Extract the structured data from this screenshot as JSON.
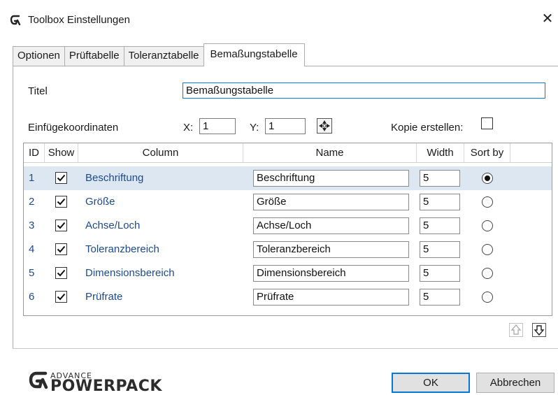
{
  "window": {
    "title": "Toolbox Einstellungen",
    "close_glyph": "✕"
  },
  "tabs": [
    {
      "label": "Optionen"
    },
    {
      "label": "Prüftabelle"
    },
    {
      "label": "Toleranztabelle"
    },
    {
      "label": "Bemaßungstabelle",
      "active": true
    }
  ],
  "form": {
    "titel_label": "Titel",
    "titel_value": "Bemaßungstabelle",
    "coords_label": "Einfügekoordinaten",
    "x_label": "X:",
    "x_value": "1",
    "y_label": "Y:",
    "y_value": "1",
    "copy_label": "Kopie erstellen:",
    "copy_checked": false
  },
  "grid": {
    "headers": {
      "id": "ID",
      "show": "Show",
      "column": "Column",
      "name": "Name",
      "width": "Width",
      "sort": "Sort by"
    },
    "rows": [
      {
        "id": "1",
        "show": true,
        "column": "Beschriftung",
        "name": "Beschriftung",
        "width": "5",
        "sort": true,
        "selected": true
      },
      {
        "id": "2",
        "show": true,
        "column": "Größe",
        "name": "Größe",
        "width": "5",
        "sort": false
      },
      {
        "id": "3",
        "show": true,
        "column": "Achse/Loch",
        "name": "Achse/Loch",
        "width": "5",
        "sort": false
      },
      {
        "id": "4",
        "show": true,
        "column": "Toleranzbereich",
        "name": "Toleranzbereich",
        "width": "5",
        "sort": false
      },
      {
        "id": "5",
        "show": true,
        "column": "Dimensionsbereich",
        "name": "Dimensionsbereich",
        "width": "5",
        "sort": false
      },
      {
        "id": "6",
        "show": true,
        "column": "Prüfrate",
        "name": "Prüfrate",
        "width": "5",
        "sort": false
      }
    ]
  },
  "logo": {
    "small": "ADVANCE",
    "big": "POWERPACK"
  },
  "buttons": {
    "ok": "OK",
    "cancel": "Abbrechen"
  },
  "colors": {
    "accent": "#0078d7",
    "row_selected": "#dde7f2",
    "link_text": "#1e4a8a"
  },
  "icons": [
    "app-logo-icon",
    "close-icon",
    "pick-point-icon",
    "move-up-icon",
    "move-down-icon",
    "checkmark-icon"
  ]
}
